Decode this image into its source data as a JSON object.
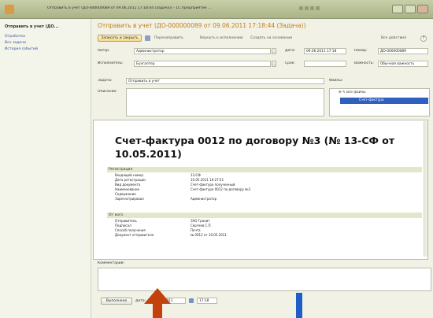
{
  "window": {
    "title": "Отправить в учет (ДО-000000089 от 09.06.2011 17:18:44 (Задача)) - 1С:Предприятие ..."
  },
  "left_panel": {
    "title": "Отправить в учет (ДО...",
    "items": [
      "Отработка",
      "Все задачи",
      "История событий"
    ]
  },
  "main": {
    "title": "Отправить в учет (ДО-000000089 от 09.06.2011 17:18:44 (Задача))"
  },
  "toolbar": {
    "execute_label": "Записать и закрыть",
    "forward_label": "Перенаправить",
    "return_label": "Вернуть к исполнению",
    "subtasks_label": "Создать на основании",
    "all_actions_label": "Все действия"
  },
  "fields": {
    "author_label": "Автор:",
    "author_value": "Администратор",
    "date_label": "Дата:",
    "date_value": "09.06.2011 17:18",
    "number_label": "Номер:",
    "number_value": "ДО-000000089",
    "performer_label": "Исполнитель:",
    "performer_value": "Бухгалтер",
    "term_label": "Срок:",
    "term_value": "",
    "importance_label": "Важность:",
    "importance_value": "Обычная важность",
    "task_label": "Задача:",
    "task_value": "Отправить в учет",
    "description_label": "Описание:",
    "files_label": "Файлы:",
    "files_header": "Все файлы",
    "files_selected": "Счет-фактура"
  },
  "document": {
    "heading": "Счет-фактура 0012 по договору №3 (№ 13-СФ от 10.05.2011)",
    "section1": "Регистрация",
    "rows1": [
      {
        "k": "Входящий номер",
        "v": "13-СФ"
      },
      {
        "k": "Дата регистрации",
        "v": "10.05.2011 16:27:51"
      },
      {
        "k": "Вид документа",
        "v": "Счет-фактура полученный"
      },
      {
        "k": "Наименование",
        "v": "Счет-фактура 0012 по договору №3"
      },
      {
        "k": "Содержание",
        "v": ""
      },
      {
        "k": "Зарегистрировал",
        "v": "Администратор"
      }
    ],
    "section2": "От кого",
    "rows2": [
      {
        "k": "Отправитель",
        "v": "ЗАО Гранит"
      },
      {
        "k": "Подписал",
        "v": "Сергеев С.П."
      },
      {
        "k": "Способ получения",
        "v": "Почта"
      },
      {
        "k": "Документ отправителя",
        "v": "№ 0012 от 10.05.2011"
      }
    ]
  },
  "comment_label": "Комментарий:",
  "bottom": {
    "execute_label": "Выполнено",
    "date_label": "Дата:",
    "date_value": "09.06.2011",
    "time_value": "17:18"
  }
}
